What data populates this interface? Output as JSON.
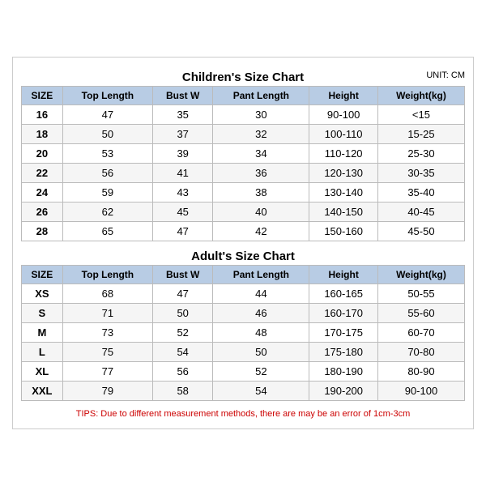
{
  "childrenTitle": "Children's Size Chart",
  "adultTitle": "Adult's Size Chart",
  "unitLabel": "UNIT: CM",
  "columns": [
    "SIZE",
    "Top Length",
    "Bust W",
    "Pant Length",
    "Height",
    "Weight(kg)"
  ],
  "childrenRows": [
    [
      "16",
      "47",
      "35",
      "30",
      "90-100",
      "<15"
    ],
    [
      "18",
      "50",
      "37",
      "32",
      "100-110",
      "15-25"
    ],
    [
      "20",
      "53",
      "39",
      "34",
      "110-120",
      "25-30"
    ],
    [
      "22",
      "56",
      "41",
      "36",
      "120-130",
      "30-35"
    ],
    [
      "24",
      "59",
      "43",
      "38",
      "130-140",
      "35-40"
    ],
    [
      "26",
      "62",
      "45",
      "40",
      "140-150",
      "40-45"
    ],
    [
      "28",
      "65",
      "47",
      "42",
      "150-160",
      "45-50"
    ]
  ],
  "adultRows": [
    [
      "XS",
      "68",
      "47",
      "44",
      "160-165",
      "50-55"
    ],
    [
      "S",
      "71",
      "50",
      "46",
      "160-170",
      "55-60"
    ],
    [
      "M",
      "73",
      "52",
      "48",
      "170-175",
      "60-70"
    ],
    [
      "L",
      "75",
      "54",
      "50",
      "175-180",
      "70-80"
    ],
    [
      "XL",
      "77",
      "56",
      "52",
      "180-190",
      "80-90"
    ],
    [
      "XXL",
      "79",
      "58",
      "54",
      "190-200",
      "90-100"
    ]
  ],
  "tips": "TIPS: Due to different measurement methods, there are may be an error of 1cm-3cm"
}
